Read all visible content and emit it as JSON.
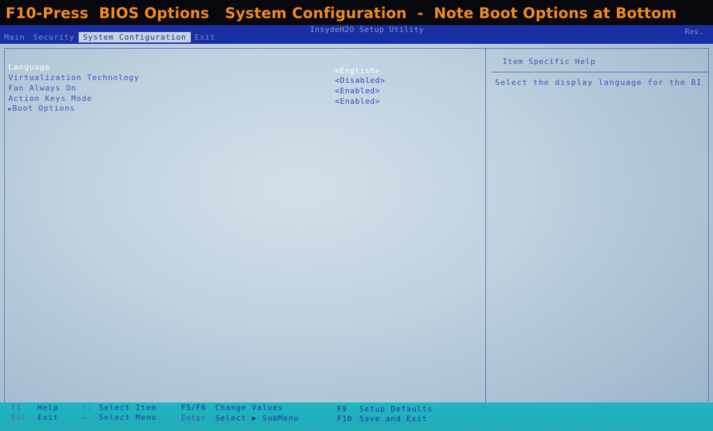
{
  "caption": "F10-Press  BIOS Options   System Configuration  -  Note Boot Options at Bottom",
  "header": {
    "utility_title": "InsydeH2O Setup Utility",
    "rev": "Rev."
  },
  "tabs": [
    {
      "label": "Main",
      "active": false
    },
    {
      "label": "Security",
      "active": false
    },
    {
      "label": "System Configuration",
      "active": true
    },
    {
      "label": "Exit",
      "active": false
    }
  ],
  "items": [
    {
      "label": "Language",
      "value": "<English>",
      "selected": true
    },
    {
      "label": "Virtualization Technology",
      "value": "<Disabled>",
      "selected": false
    },
    {
      "label": "Fan Always On",
      "value": "<Enabled>",
      "selected": false
    },
    {
      "label": "Action Keys Mode",
      "value": "<Enabled>",
      "selected": false
    },
    {
      "label": "Boot Options",
      "submenu": true,
      "selected": false
    }
  ],
  "help": {
    "title": "Item Specific Help",
    "text": "Select the display language for the BI"
  },
  "footer": {
    "rows": [
      [
        {
          "key": "F1",
          "desc": "Help"
        },
        {
          "key": "↑↓",
          "desc": "Select Item"
        },
        {
          "key": "F5/F6",
          "desc": "Change Values"
        },
        {
          "key": "F9",
          "desc": "Setup Defaults"
        }
      ],
      [
        {
          "key": "Esc",
          "desc": "Exit"
        },
        {
          "key": "↔",
          "desc": "Select Menu"
        },
        {
          "key": "Enter",
          "desc": "Select ▶ SubMenu"
        },
        {
          "key": "F10",
          "desc": "Save and Exit"
        }
      ]
    ]
  },
  "colors": {
    "caption_text": "#f5891f",
    "menubar_bg": "#1730a8",
    "screen_bg": "#c0d1df",
    "footer_bg": "#1fb6c0"
  }
}
